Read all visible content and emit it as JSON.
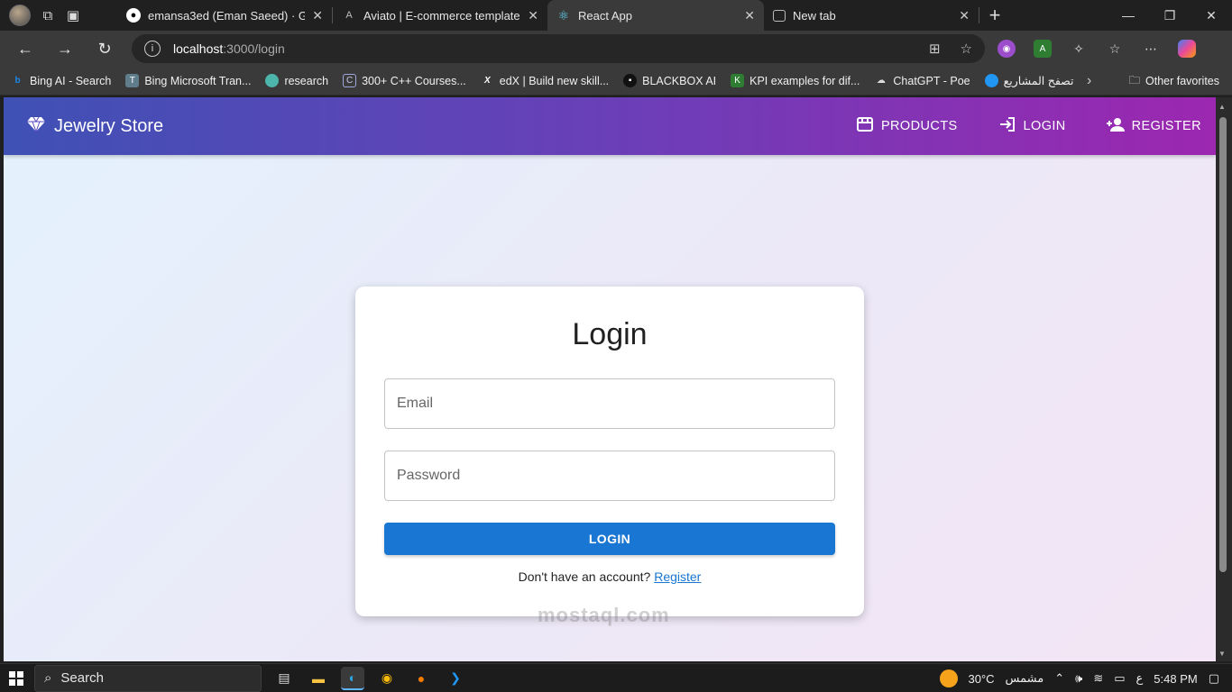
{
  "browser": {
    "tabs": [
      {
        "title": "emansa3ed (Eman Saeed) · GitHub",
        "favicon": "github-icon",
        "active": false
      },
      {
        "title": "Aviato | E-commerce template",
        "favicon": "aviato-icon",
        "active": false
      },
      {
        "title": "React App",
        "favicon": "react-icon",
        "active": true
      },
      {
        "title": "New tab",
        "favicon": "newtab-icon",
        "active": false
      }
    ],
    "address": {
      "host": "localhost",
      "path": ":3000/login"
    },
    "favorites": [
      {
        "label": "Bing AI - Search",
        "icon": "bing-icon",
        "color": "#1e88e5"
      },
      {
        "label": "Bing Microsoft Tran...",
        "icon": "translator-icon",
        "color": "#607d8b"
      },
      {
        "label": "research",
        "icon": "research-icon",
        "color": "#26a69a"
      },
      {
        "label": "300+ C++ Courses...",
        "icon": "course-icon",
        "color": "#5c6bc0"
      },
      {
        "label": "edX | Build new skill...",
        "icon": "edx-icon",
        "color": "#000000"
      },
      {
        "label": "BLACKBOX AI",
        "icon": "blackbox-icon",
        "color": "#111111"
      },
      {
        "label": "KPI examples for dif...",
        "icon": "kpi-icon",
        "color": "#2e7d32"
      },
      {
        "label": "ChatGPT - Poe",
        "icon": "poe-icon",
        "color": "#5e35b1"
      },
      {
        "label": "تصفح المشاريع",
        "icon": "mostaql-icon",
        "color": "#2196f3"
      }
    ],
    "other_favorites": "Other favorites"
  },
  "app": {
    "brand": "Jewelry Store",
    "nav": [
      {
        "label": "PRODUCTS",
        "icon": "store-icon"
      },
      {
        "label": "LOGIN",
        "icon": "login-icon"
      },
      {
        "label": "REGISTER",
        "icon": "person-add-icon"
      }
    ],
    "colors": {
      "appbar_start": "#3f51b5",
      "appbar_end": "#9c27b0",
      "primary": "#1976d2"
    }
  },
  "login": {
    "title": "Login",
    "email_label": "Email",
    "password_label": "Password",
    "button": "LOGIN",
    "prompt": "Don't have an account?",
    "register_link": "Register"
  },
  "watermark": "mostaql.com",
  "taskbar": {
    "search": "Search",
    "temperature": "30°C",
    "weather": "مشمس",
    "lang": "ع",
    "time": "5:48 PM"
  }
}
